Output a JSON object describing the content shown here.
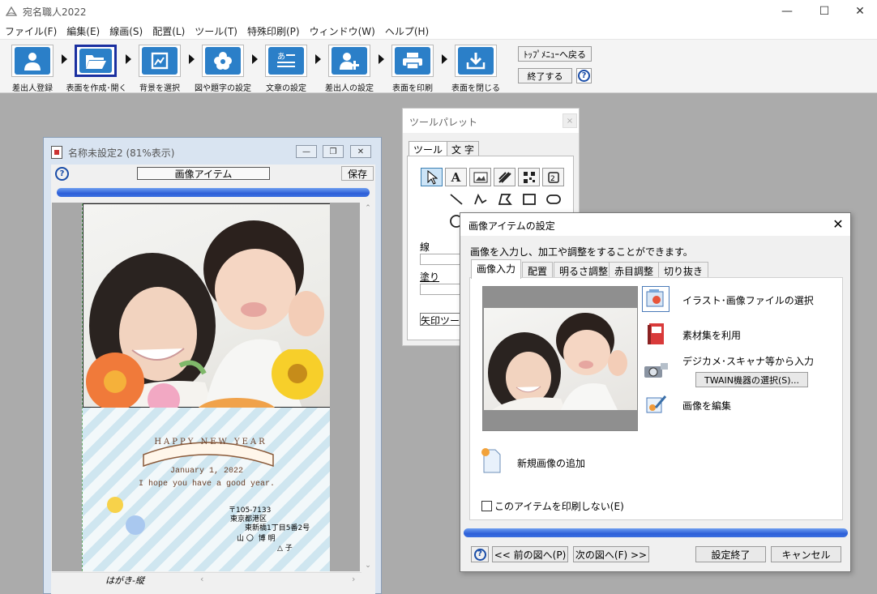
{
  "app": {
    "title": "宛名職人2022"
  },
  "window_controls": {
    "minimize": "—",
    "maximize": "☐",
    "close": "✕"
  },
  "menu": [
    "ファイル(F)",
    "編集(E)",
    "線画(S)",
    "配置(L)",
    "ツール(T)",
    "特殊印刷(P)",
    "ウィンドウ(W)",
    "ヘルプ(H)"
  ],
  "toolbar": {
    "steps": [
      {
        "label": "差出人登録",
        "icon": "person-icon"
      },
      {
        "label": "表面を作成･開く",
        "icon": "folder-open-icon",
        "selected": true
      },
      {
        "label": "背景を選択",
        "icon": "picture-icon"
      },
      {
        "label": "図や題字の設定",
        "icon": "flower-icon"
      },
      {
        "label": "文章の設定",
        "icon": "text-lines-icon"
      },
      {
        "label": "差出人の設定",
        "icon": "person-add-icon"
      },
      {
        "label": "表面を印刷",
        "icon": "printer-icon"
      },
      {
        "label": "表面を閉じる",
        "icon": "download-tray-icon"
      }
    ],
    "top_menu_button": "ﾄｯﾌﾟﾒﾆｭｰへ戻る",
    "exit_button": "終了する",
    "help": "?"
  },
  "document": {
    "title": "名称未設定2 (81%表示)",
    "item_label": "画像アイテム",
    "save_button": "保存",
    "help": "?",
    "status_label": "はがき-縦",
    "card": {
      "greeting": "HAPPY NEW YEAR",
      "date": "January 1, 2022",
      "message": "I hope you have a good year.",
      "postal": "〒105-7133",
      "address1": "東京都港区",
      "address2": "東新橋1丁目5番2号",
      "name1": "山 〇  博 明",
      "name2": "△ 子"
    }
  },
  "palette": {
    "title": "ツールパレット",
    "close": "×",
    "tabs": [
      "ツール",
      "文 字"
    ],
    "tools_row1": [
      "select-arrow-icon",
      "text-tool-icon",
      "image-tool-icon",
      "pattern-tool-icon",
      "qr-code-icon",
      "stamp-tool-icon"
    ],
    "tools_row2": [
      "line-tool-icon",
      "polyline-tool-icon",
      "polygon-tool-icon",
      "rectangle-tool-icon",
      "rounded-rect-tool-icon"
    ],
    "line_label": "線",
    "fill_label": "塗り",
    "status_text": "矢印ツール"
  },
  "dialog": {
    "title": "画像アイテムの設定",
    "close": "✕",
    "description": "画像を入力し、加工や調整をすることができます。",
    "tabs": [
      "画像入力",
      "配置",
      "明るさ調整",
      "赤目調整",
      "切り抜き"
    ],
    "active_tab": "画像入力",
    "options": {
      "select_file": "イラスト･画像ファイルの選択",
      "material": "素材集を利用",
      "camera_input": "デジカメ･スキャナ等から入力",
      "twain_button": "TWAIN機器の選択(S)...",
      "edit_image": "画像を編集",
      "new_image": "新規画像の追加"
    },
    "no_print_label": "このアイテムを印刷しない(E)",
    "no_print_checked": false,
    "buttons": {
      "help": "?",
      "prev": "<< 前の図へ(P)",
      "next": "次の図へ(F) >>",
      "finish": "設定終了",
      "cancel": "キャンセル"
    }
  },
  "colors": {
    "toolbar_icon_blue": "#2b7fc8",
    "selected_border": "#1a2fa0",
    "progress_blue": "#2d5fd8",
    "canvas_gray": "#ababab"
  }
}
